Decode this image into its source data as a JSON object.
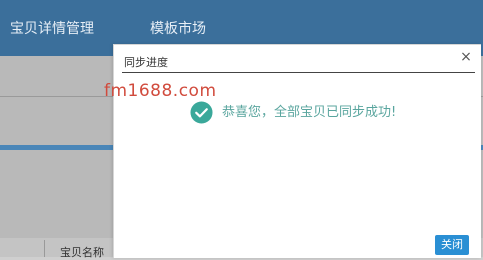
{
  "app": {
    "nav": [
      "宝贝详情管理",
      "模板市场"
    ],
    "table_header": {
      "col_name": "宝贝名称"
    }
  },
  "dialog": {
    "title": "同步进度",
    "close_symbol": "×",
    "message": "恭喜您，全部宝贝已同步成功!",
    "close_button_label": "关闭",
    "success_icon": "check-circle",
    "accent_color": "#2a8fd4",
    "success_color": "#3aa89a"
  },
  "watermark": "fm1688.com"
}
